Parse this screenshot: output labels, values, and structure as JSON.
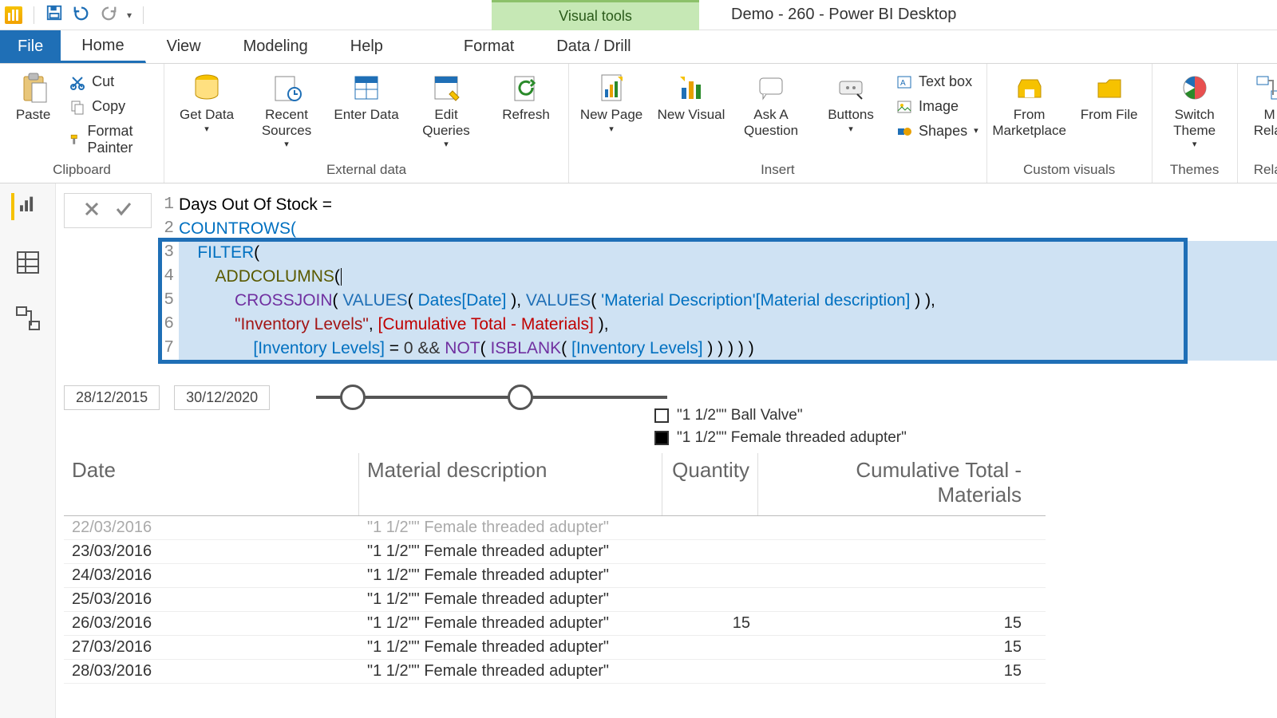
{
  "titlebar": {
    "context_tab": "Visual tools",
    "doc_title": "Demo - 260 - Power BI Desktop"
  },
  "menutabs": {
    "file": "File",
    "home": "Home",
    "view": "View",
    "modeling": "Modeling",
    "help": "Help",
    "format": "Format",
    "datadrill": "Data / Drill"
  },
  "ribbon": {
    "clipboard": {
      "label": "Clipboard",
      "paste": "Paste",
      "cut": "Cut",
      "copy": "Copy",
      "format_painter": "Format Painter"
    },
    "external": {
      "label": "External data",
      "get_data": "Get Data",
      "recent_sources": "Recent Sources",
      "enter_data": "Enter Data",
      "edit_queries": "Edit Queries",
      "refresh": "Refresh"
    },
    "insert": {
      "label": "Insert",
      "new_page": "New Page",
      "new_visual": "New Visual",
      "ask": "Ask A Question",
      "buttons": "Buttons",
      "text_box": "Text box",
      "image": "Image",
      "shapes": "Shapes"
    },
    "custom": {
      "label": "Custom visuals",
      "marketplace": "From Marketplace",
      "file": "From File"
    },
    "themes": {
      "label": "Themes",
      "switch": "Switch Theme"
    },
    "relat": {
      "label": "Relat",
      "manage": "M\nRelat"
    }
  },
  "formula": {
    "lines": {
      "l1": "Days Out Of Stock =",
      "l2": "COUNTROWS(",
      "l3_filter": "FILTER",
      "l4_addcol": "ADDCOLUMNS",
      "l5_cross": "CROSSJOIN",
      "l5_values": "VALUES",
      "l5_col1": "Dates[Date]",
      "l5_col2": "'Material Description'[Material description]",
      "l6_str": "\"Inventory Levels\"",
      "l6_meas": "[Cumulative Total - Materials]",
      "l7_col": "[Inventory Levels]",
      "l7_zero": "0",
      "l7_amp": "&&",
      "l7_not": "NOT",
      "l7_isbl": "ISBLANK",
      "l7_end": " ) ) ) )"
    }
  },
  "slicer": {
    "from": "28/12/2015",
    "to": "30/12/2020"
  },
  "legend": {
    "item1": "\"1 1/2\"\" Ball Valve\"",
    "item2": "\"1 1/2\"\" Female threaded adupter\""
  },
  "table": {
    "headers": {
      "date": "Date",
      "mat": "Material description",
      "qty": "Quantity",
      "cum": "Cumulative Total - Materials"
    },
    "rows": [
      {
        "date": "22/03/2016",
        "mat": "\"1 1/2\"\" Female threaded adupter\"",
        "qty": "",
        "cum": ""
      },
      {
        "date": "23/03/2016",
        "mat": "\"1 1/2\"\" Female threaded adupter\"",
        "qty": "",
        "cum": ""
      },
      {
        "date": "24/03/2016",
        "mat": "\"1 1/2\"\" Female threaded adupter\"",
        "qty": "",
        "cum": ""
      },
      {
        "date": "25/03/2016",
        "mat": "\"1 1/2\"\" Female threaded adupter\"",
        "qty": "",
        "cum": ""
      },
      {
        "date": "26/03/2016",
        "mat": "\"1 1/2\"\" Female threaded adupter\"",
        "qty": "15",
        "cum": "15"
      },
      {
        "date": "27/03/2016",
        "mat": "\"1 1/2\"\" Female threaded adupter\"",
        "qty": "",
        "cum": "15"
      },
      {
        "date": "28/03/2016",
        "mat": "\"1 1/2\"\" Female threaded adupter\"",
        "qty": "",
        "cum": "15"
      }
    ]
  }
}
